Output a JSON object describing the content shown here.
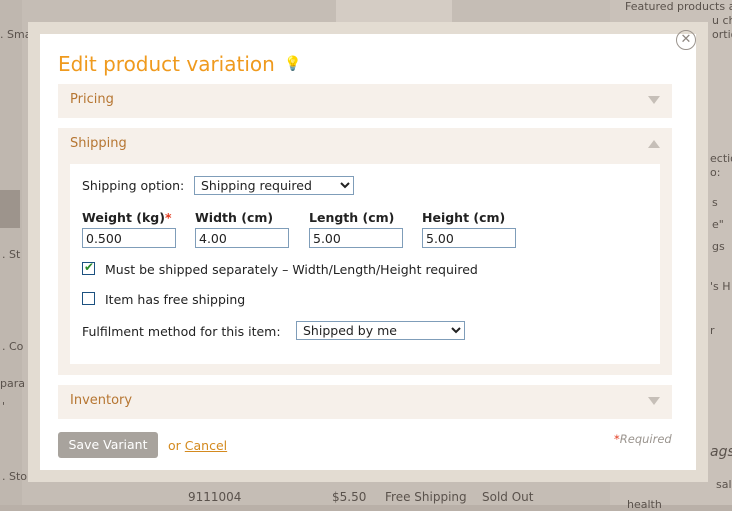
{
  "background": {
    "left_texts": [
      ". Sma",
      ". St",
      ". Co",
      "para",
      "'",
      ". Sto"
    ],
    "right_texts": [
      "Featured products a",
      "u ch",
      "ortio",
      "ectio",
      "o:",
      "s",
      "e\"",
      "gs",
      "'s H",
      "r",
      "ags",
      "sal",
      "health"
    ],
    "bottom_row": {
      "sku": "9111004",
      "price": "$5.50",
      "shipping": "Free Shipping",
      "status": "Sold Out"
    }
  },
  "modal": {
    "title": "Edit product variation",
    "close_icon": "close-circle-icon",
    "bulb_icon": "lightbulb-icon",
    "sections": {
      "pricing": {
        "label": "Pricing"
      },
      "shipping": {
        "label": "Shipping"
      },
      "inventory": {
        "label": "Inventory"
      }
    },
    "shipping": {
      "option_label": "Shipping option:",
      "option_value": "Shipping required",
      "fields": [
        {
          "label": "Weight (kg)",
          "required": "*",
          "value": "0.500"
        },
        {
          "label": "Width (cm)",
          "value": "4.00"
        },
        {
          "label": "Length (cm)",
          "value": "5.00"
        },
        {
          "label": "Height (cm)",
          "value": "5.00"
        }
      ],
      "ship_separately_label": "Must be shipped separately – Width/Length/Height required",
      "ship_separately_checked": true,
      "free_shipping_label": "Item has free shipping",
      "free_shipping_checked": false,
      "fulfilment_label": "Fulfilment method for this item:",
      "fulfilment_value": "Shipped by me"
    },
    "actions": {
      "save_label": "Save Variant",
      "or_text": "or",
      "cancel_label": "Cancel",
      "required_star": "*",
      "required_text": "Required"
    }
  }
}
